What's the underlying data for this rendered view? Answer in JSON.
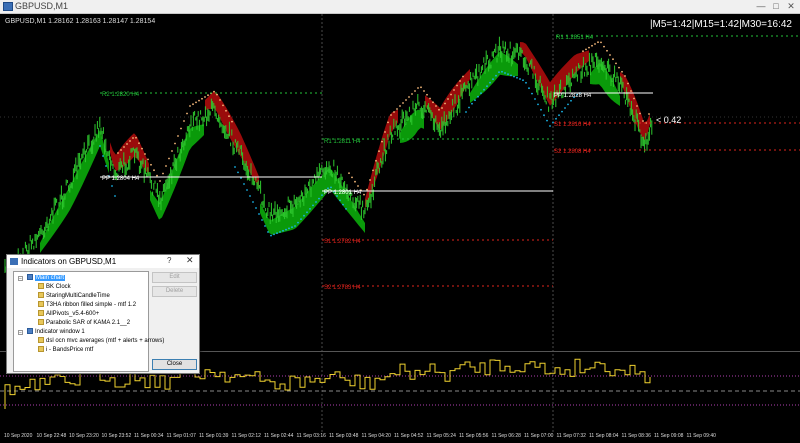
{
  "window": {
    "title": "GBPUSD,M1",
    "min_label": "—",
    "max_label": "□",
    "close_label": "✕"
  },
  "chart": {
    "symbol_line": "GBPUSD,M1  1.28162 1.28163 1.28147 1.28154",
    "clock_text": "|M5=1:42|M15=1:42|M30=16:42",
    "price_tag": "< 0.42",
    "pivot_labels": [
      {
        "text": "R1 1.2851 H4",
        "color": "green"
      },
      {
        "text": "R2 1.2820 H4",
        "color": "green"
      },
      {
        "text": "PP 1.2828 H4",
        "color": "white"
      },
      {
        "text": "S1 1.2816 H4",
        "color": "red"
      },
      {
        "text": "S2 1.2808 H4",
        "color": "red"
      },
      {
        "text": "PP 1.2804 H4",
        "color": "white"
      },
      {
        "text": "R1 1.2811 H4",
        "color": "green"
      },
      {
        "text": "PP 1.2801 H4",
        "color": "white"
      },
      {
        "text": "S1 1.2782 H4",
        "color": "red"
      },
      {
        "text": "S2 1.2783 H4",
        "color": "red"
      }
    ],
    "time_labels": [
      "10 Sep 2020",
      "10 Sep 22:48",
      "10 Sep 23:20",
      "10 Sep 23:52",
      "11 Sep 00:34",
      "11 Sep 01:07",
      "11 Sep 01:39",
      "11 Sep 02:12",
      "11 Sep 02:44",
      "11 Sep 03:16",
      "11 Sep 03:48",
      "11 Sep 04:20",
      "11 Sep 04:52",
      "11 Sep 05:24",
      "11 Sep 05:56",
      "11 Sep 06:28",
      "11 Sep 07:00",
      "11 Sep 07:32",
      "11 Sep 08:04",
      "11 Sep 08:36",
      "11 Sep 09:08",
      "11 Sep 09:40"
    ]
  },
  "dialog": {
    "title": "Indicators on GBPUSD,M1",
    "help_label": "?",
    "close_x": "✕",
    "tree": [
      {
        "label": "Main chart",
        "type": "chart",
        "selected": true
      },
      {
        "label": "BK Clock",
        "type": "indicator"
      },
      {
        "label": "StaringMultiCandleTime",
        "type": "indicator"
      },
      {
        "label": "T3HA ribbon filled simple - mtf 1.2",
        "type": "indicator"
      },
      {
        "label": "AllPivots_v5.4-600+",
        "type": "indicator"
      },
      {
        "label": "Parabolic SAR of KAMA 2.1__2",
        "type": "indicator"
      },
      {
        "label": "Indicator window 1",
        "type": "chart"
      },
      {
        "label": "dsl ocn mvc averages (mtf + alerts + arrows)",
        "type": "indicator"
      },
      {
        "label": "i - BandsPrice mtf",
        "type": "indicator"
      }
    ],
    "buttons": {
      "edit": "Edit",
      "delete": "Delete",
      "close": "Close"
    }
  },
  "colors": {
    "background": "#000000",
    "bull_ribbon": "#0a9a0a",
    "bear_ribbon": "#9a0b0b",
    "candles": "#2ec82e",
    "sar_up": "#19b3e6",
    "sar_down": "#f5b87a",
    "osc": "#f0d230"
  }
}
